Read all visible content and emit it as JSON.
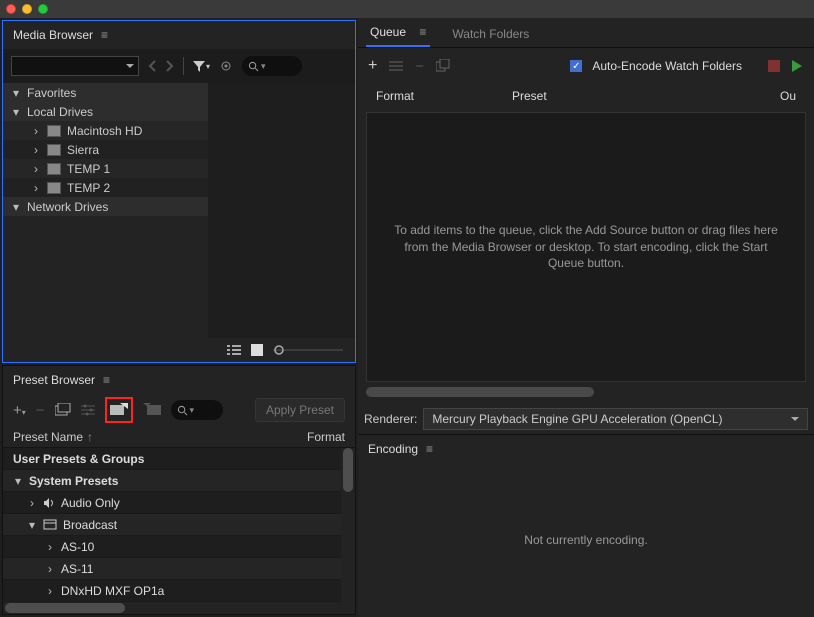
{
  "titlebar": {},
  "media_browser": {
    "title": "Media Browser",
    "tree": {
      "favorites": "Favorites",
      "local_drives": "Local Drives",
      "network_drives": "Network Drives",
      "items": [
        {
          "label": "Macintosh HD"
        },
        {
          "label": "Sierra"
        },
        {
          "label": "TEMP 1"
        },
        {
          "label": "TEMP 2"
        }
      ]
    }
  },
  "preset_browser": {
    "title": "Preset Browser",
    "apply": "Apply Preset",
    "col_name": "Preset Name",
    "col_format": "Format",
    "rows": {
      "user": "User Presets & Groups",
      "system": "System Presets",
      "audio": "Audio Only",
      "broadcast": "Broadcast",
      "as10": "AS-10",
      "as11": "AS-11",
      "dnxhd": "DNxHD MXF OP1a"
    }
  },
  "queue": {
    "tab_queue": "Queue",
    "tab_watch": "Watch Folders",
    "auto_encode": "Auto-Encode Watch Folders",
    "col_format": "Format",
    "col_preset": "Preset",
    "col_output": "Ou",
    "empty": "To add items to the queue, click the Add Source button or drag files here from the Media Browser or desktop.  To start encoding, click the Start Queue button.",
    "renderer_label": "Renderer:",
    "renderer_value": "Mercury Playback Engine GPU Acceleration (OpenCL)"
  },
  "encoding": {
    "title": "Encoding",
    "status": "Not currently encoding."
  }
}
